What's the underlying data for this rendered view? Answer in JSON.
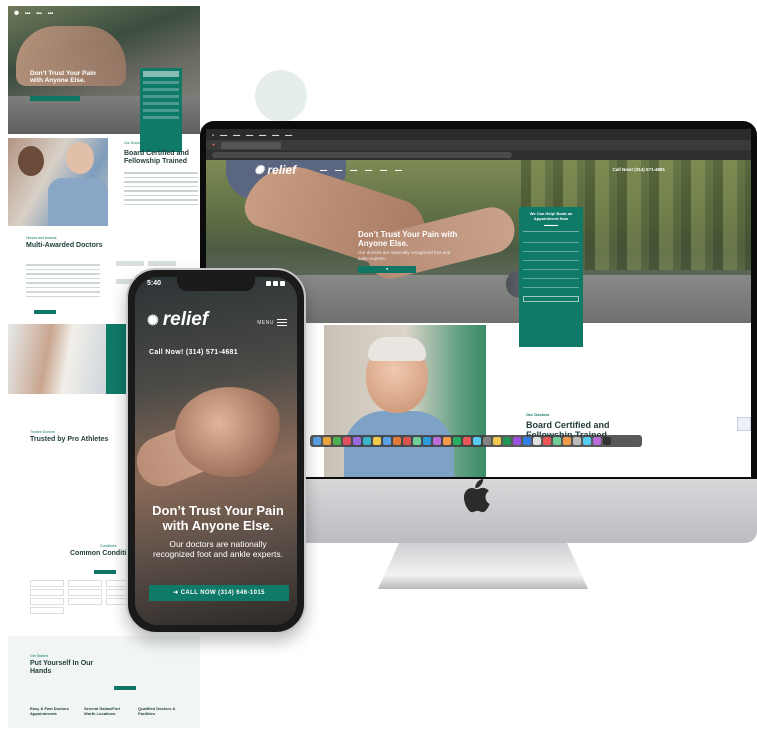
{
  "colors": {
    "brand_teal": "#107a68",
    "dark_text": "#1f3b3a",
    "light_band": "#f1f6f5"
  },
  "mobile": {
    "status_time": "5:40",
    "logo": "relief",
    "menu_label": "MENU",
    "call_now": "Call Now! (314) 571-4681",
    "hero_title": "Don’t Trust Your Pain with Anyone Else.",
    "hero_subtitle": "Our doctors are nationally recognized foot and ankle experts.",
    "cta_button": "CALL NOW (314) 646-1015"
  },
  "desktop": {
    "logo": "relief",
    "nav_call": "Call Now! (314) 571-4681",
    "hero_title": "Don’t Trust Your Pain with Anyone Else.",
    "hero_subtitle": "Our doctors are nationally recognized foot and ankle experts.",
    "form_title": "We Can Help! Book an Appointment Now",
    "our_doctors_label": "Our Doctors",
    "section_title": "Board Certified and Fellowship Trained"
  },
  "longpage": {
    "hero_title": "Don’t Trust Your Pain with Anyone Else.",
    "board_title": "Board Certified and Fellowship Trained",
    "awards_label": "Honors and Awards",
    "awards_title": "Multi-Awarded Doctors",
    "trusted_label": "Trusted Doctors",
    "trusted_title": "Trusted by Pro Athletes",
    "conditions_label": "Conditions",
    "conditions_title": "Common Conditions",
    "getstarted_label": "Get Started",
    "getstarted_title": "Put Yourself In Our Hands",
    "stats": [
      "Easy & Fast Doctors Appointments",
      "Several Dallas/Fort Worth Locations",
      "Qualified Doctors & Facilities"
    ]
  }
}
